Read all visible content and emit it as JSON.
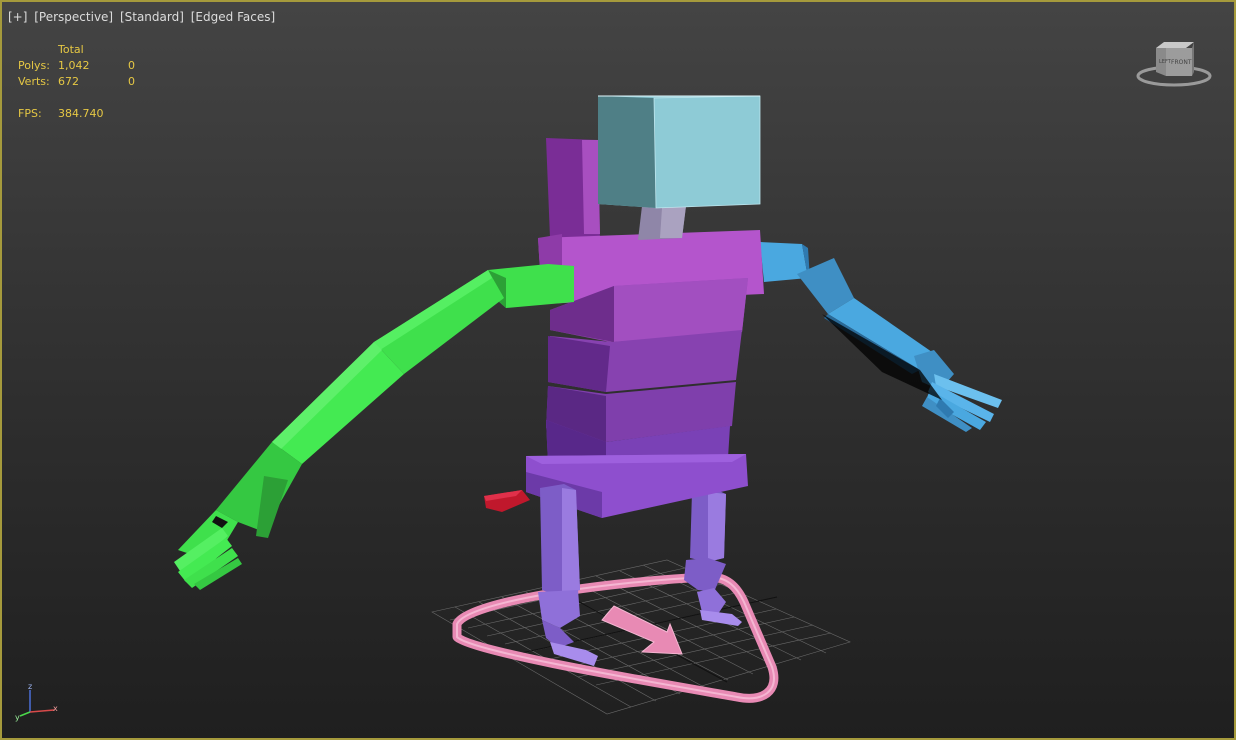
{
  "viewport": {
    "labels": [
      "[+]",
      "[Perspective]",
      "[Standard]",
      "[Edged Faces]"
    ],
    "border_color": "#a59a3c"
  },
  "stats": {
    "header": "Total",
    "rows": [
      {
        "label": "Polys:",
        "total": "1,042",
        "selected": "0"
      },
      {
        "label": "Verts:",
        "total": "672",
        "selected": "0"
      }
    ],
    "fps_label": "FPS:",
    "fps_value": "384.740",
    "color": "#e6c844"
  },
  "viewcube": {
    "face_left": "LEFT",
    "face_front": "FRONT"
  },
  "axis": {
    "x": "x",
    "y": "y",
    "z": "z"
  },
  "scene": {
    "objects": [
      {
        "name": "head",
        "color": "#8ecbd6"
      },
      {
        "name": "torso",
        "color": "#a84fc0"
      },
      {
        "name": "pelvis",
        "color": "#8e4fce"
      },
      {
        "name": "left-arm",
        "color": "#3fe04c"
      },
      {
        "name": "right-arm",
        "color": "#4aa8e0"
      },
      {
        "name": "legs",
        "color": "#8f70d9"
      },
      {
        "name": "root-control",
        "color": "#e88ab4"
      },
      {
        "name": "tail-bone",
        "color": "#c0182c"
      }
    ]
  }
}
